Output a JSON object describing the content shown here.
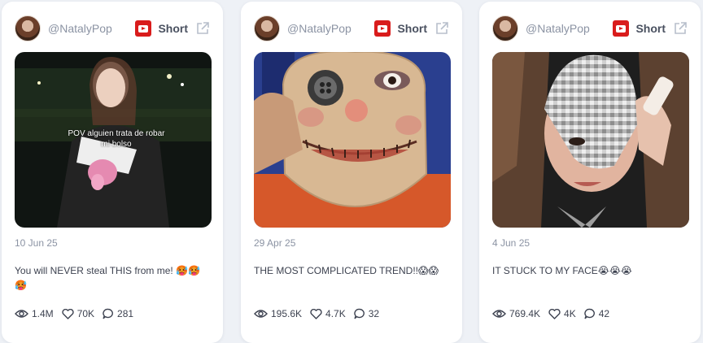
{
  "cards": [
    {
      "handle": "@NatalyPop",
      "type_label": "Short",
      "date": "10 Jun 25",
      "thumbnail_overlay": "POV alguien trata de robar mi bolso",
      "caption": "You will NEVER steal THIS from me! 🥵🥵🥵",
      "views": "1.4M",
      "likes": "70K",
      "comments": "281"
    },
    {
      "handle": "@NatalyPop",
      "type_label": "Short",
      "date": "29 Apr 25",
      "caption": "THE MOST COMPLICATED TREND!!😱😱",
      "views": "195.6K",
      "likes": "4.7K",
      "comments": "32"
    },
    {
      "handle": "@NatalyPop",
      "type_label": "Short",
      "date": "4 Jun 25",
      "caption": "IT STUCK TO MY FACE😭😭😭",
      "views": "769.4K",
      "likes": "4K",
      "comments": "42"
    }
  ],
  "colors": {
    "youtube_red": "#d91c1c",
    "muted": "#8b93a3",
    "background": "#eef1f6"
  },
  "icons": [
    "youtube-icon",
    "external-link-icon",
    "eye-icon",
    "heart-icon",
    "comment-icon"
  ]
}
